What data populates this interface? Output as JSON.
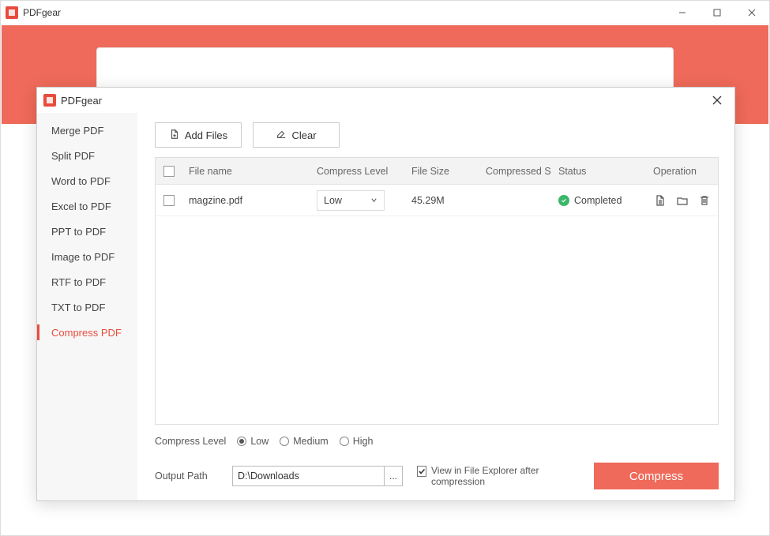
{
  "outer": {
    "title": "PDFgear"
  },
  "inner": {
    "title": "PDFgear"
  },
  "sidebar": {
    "items": [
      {
        "label": "Merge PDF"
      },
      {
        "label": "Split PDF"
      },
      {
        "label": "Word to PDF"
      },
      {
        "label": "Excel to PDF"
      },
      {
        "label": "PPT to PDF"
      },
      {
        "label": "Image to PDF"
      },
      {
        "label": "RTF to PDF"
      },
      {
        "label": "TXT to PDF"
      },
      {
        "label": "Compress PDF"
      }
    ],
    "active_index": 8
  },
  "toolbar": {
    "add_files_label": "Add Files",
    "clear_label": "Clear"
  },
  "table": {
    "headers": {
      "filename": "File name",
      "compress_level": "Compress Level",
      "file_size": "File Size",
      "compressed_size": "Compressed S",
      "status": "Status",
      "operation": "Operation"
    },
    "rows": [
      {
        "checked": false,
        "filename": "magzine.pdf",
        "level": "Low",
        "size": "45.29M",
        "compressed_size": "",
        "status": "Completed",
        "status_ok": true
      }
    ]
  },
  "compress_level": {
    "label": "Compress Level",
    "options": [
      "Low",
      "Medium",
      "High"
    ],
    "selected": "Low"
  },
  "output": {
    "label": "Output Path",
    "path": "D:\\Downloads",
    "browse": "..."
  },
  "view_option": {
    "checked": true,
    "label": "View in File Explorer after compression"
  },
  "actions": {
    "compress": "Compress"
  }
}
